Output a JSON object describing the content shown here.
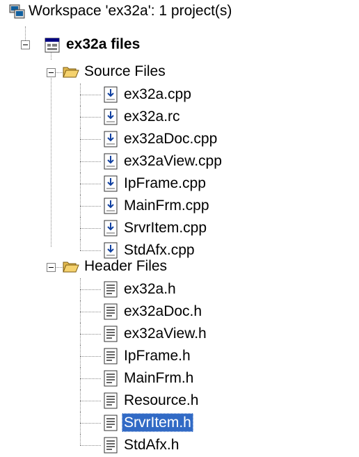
{
  "workspace": {
    "label": "Workspace 'ex32a': 1 project(s)",
    "icon": "workspace-icon"
  },
  "project": {
    "label": "ex32a files",
    "icon": "project-icon"
  },
  "folders": [
    {
      "label": "Source Files",
      "icon": "folder-open-icon",
      "files": [
        "ex32a.cpp",
        "ex32a.rc",
        "ex32aDoc.cpp",
        "ex32aView.cpp",
        "IpFrame.cpp",
        "MainFrm.cpp",
        "SrvrItem.cpp",
        "StdAfx.cpp"
      ]
    },
    {
      "label": "Header Files",
      "icon": "folder-open-icon",
      "files": [
        "ex32a.h",
        "ex32aDoc.h",
        "ex32aView.h",
        "IpFrame.h",
        "MainFrm.h",
        "Resource.h",
        "SrvrItem.h",
        "StdAfx.h"
      ]
    }
  ],
  "selected_file": "SrvrItem.h",
  "colors": {
    "selection": "#316ac5",
    "folder": "#f5d26e",
    "tree_lines": "#8a8a8a"
  }
}
